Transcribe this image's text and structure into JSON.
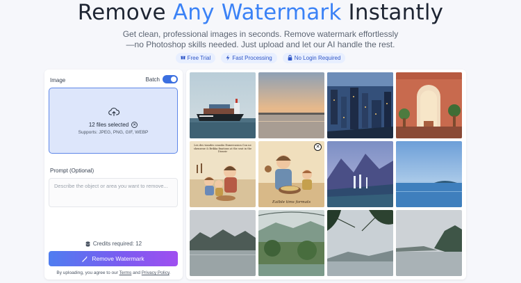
{
  "hero": {
    "title_pre": "Remove ",
    "title_accent": "Any Watermark",
    "title_post": " Instantly",
    "subtitle_line1": "Get clean, professional images in seconds. Remove watermark effortlessly",
    "subtitle_line2": "—no Photoshop skills needed. Just upload and let our AI handle the rest."
  },
  "badges": [
    {
      "icon": "gift-icon",
      "label": "Free Trial"
    },
    {
      "icon": "lightning-icon",
      "label": "Fast Processing"
    },
    {
      "icon": "lock-icon",
      "label": "No Login Required"
    }
  ],
  "panel": {
    "image_label": "Image",
    "batch_label": "Batch",
    "batch_enabled": true,
    "files_selected": "12 files selected",
    "supports": "Supports: JPEG, PNG, GIF, WEBP",
    "prompt_label": "Prompt (Optional)",
    "prompt_placeholder": "Describe the object or area you want to remove...",
    "prompt_value": "",
    "credits": "Credits required: 12",
    "remove_button": "Remove Watermark",
    "legal_pre": "By uploading, you agree to our ",
    "terms_link": "Terms",
    "legal_and": " and ",
    "privacy_link": "Privacy Policy",
    "legal_post": "."
  },
  "gallery": {
    "images": [
      {
        "subject": "cargo ship at sea"
      },
      {
        "subject": "sunset over calm water"
      },
      {
        "subject": "city skyline at dusk"
      },
      {
        "subject": "ornate room with archway"
      },
      {
        "subject": "storybook illustration of family cooking"
      },
      {
        "subject": "illustration of woman cooking with child",
        "caption": "Eatble tims formats",
        "has_remove": true
      },
      {
        "subject": "mountain waterfall landscape"
      },
      {
        "subject": "calm blue sea and sky"
      },
      {
        "subject": "misty lake with mountains"
      },
      {
        "subject": "overgrown lakeside with hills"
      },
      {
        "subject": "tree branches over water"
      },
      {
        "subject": "foggy lake shoreline"
      }
    ],
    "storybook_text": "Les des viandes cosasks Esmercasion Cou ne shenzene & Brikka fixations at the seat in the Diouzir"
  }
}
